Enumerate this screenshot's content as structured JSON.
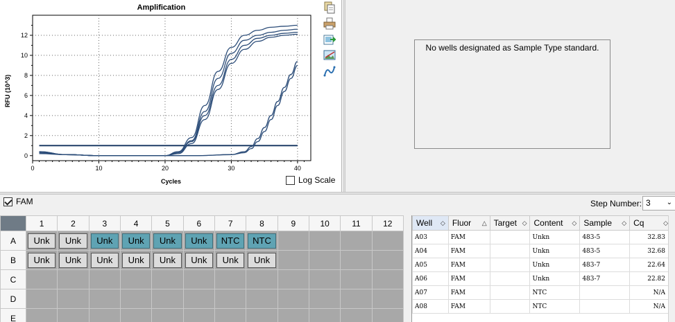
{
  "chart": {
    "title": "Amplification",
    "ylabel": "RFU (10^3)",
    "xlabel": "Cycles",
    "log_scale_label": "Log Scale"
  },
  "chart_data": {
    "type": "line",
    "title": "Amplification",
    "xlabel": "Cycles",
    "ylabel": "RFU (10^3)",
    "xlim": [
      0,
      42
    ],
    "ylim": [
      -0.5,
      14
    ],
    "xticks": [
      0,
      10,
      20,
      30,
      40
    ],
    "yticks": [
      0,
      2,
      4,
      6,
      8,
      10,
      12
    ],
    "threshold": 1.0,
    "grid": true,
    "series": [
      {
        "name": "A03",
        "x": [
          1,
          5,
          10,
          15,
          20,
          22,
          24,
          26,
          28,
          30,
          32,
          34,
          36,
          38,
          40
        ],
        "y": [
          0.4,
          0.1,
          0,
          0,
          0,
          0.3,
          1.4,
          4.0,
          7.0,
          9.6,
          11.0,
          11.7,
          12.0,
          12.2,
          12.3
        ]
      },
      {
        "name": "A04",
        "x": [
          1,
          5,
          10,
          15,
          20,
          22,
          24,
          26,
          28,
          30,
          32,
          34,
          36,
          38,
          40
        ],
        "y": [
          0.3,
          0.1,
          0,
          0,
          0,
          0.2,
          1.2,
          3.6,
          6.6,
          9.2,
          10.6,
          11.4,
          11.8,
          12.0,
          12.1
        ]
      },
      {
        "name": "A05",
        "x": [
          1,
          5,
          10,
          15,
          20,
          22,
          24,
          26,
          28,
          30,
          32,
          34,
          36,
          38,
          40
        ],
        "y": [
          0.4,
          0.1,
          0,
          0,
          0,
          0.4,
          1.8,
          5.0,
          8.4,
          10.8,
          12.0,
          12.5,
          12.8,
          12.9,
          13.0
        ]
      },
      {
        "name": "A06",
        "x": [
          1,
          5,
          10,
          15,
          20,
          22,
          24,
          26,
          28,
          30,
          32,
          34,
          36,
          38,
          40
        ],
        "y": [
          0.3,
          0.1,
          0,
          0,
          0,
          0.3,
          1.5,
          4.4,
          7.7,
          10.2,
          11.5,
          12.0,
          12.3,
          12.5,
          12.6
        ]
      },
      {
        "name": "A07",
        "x": [
          1,
          5,
          10,
          15,
          20,
          25,
          30,
          32,
          33,
          34,
          35,
          36,
          37,
          38,
          39,
          40
        ],
        "y": [
          0.3,
          0.1,
          0,
          0,
          0,
          0,
          0.1,
          0.4,
          0.9,
          1.7,
          2.8,
          4.0,
          5.4,
          6.8,
          8.1,
          9.4
        ]
      },
      {
        "name": "A08",
        "x": [
          1,
          5,
          10,
          15,
          20,
          25,
          30,
          32,
          33,
          34,
          35,
          36,
          37,
          38,
          39,
          40
        ],
        "y": [
          0.2,
          0.1,
          0,
          0,
          0,
          0,
          0.1,
          0.3,
          0.7,
          1.4,
          2.4,
          3.6,
          5.0,
          6.4,
          7.7,
          9.0
        ]
      }
    ]
  },
  "toolbar_icons": [
    "copy-icon",
    "print-icon",
    "export-icon",
    "image-icon",
    "chart-settings-icon"
  ],
  "standard": {
    "message": "No wells designated as Sample Type standard."
  },
  "fam": {
    "label": "FAM"
  },
  "step": {
    "label": "Step Number:",
    "value": "3"
  },
  "plate": {
    "columns": [
      "1",
      "2",
      "3",
      "4",
      "5",
      "6",
      "7",
      "8",
      "9",
      "10",
      "11",
      "12"
    ],
    "rows": [
      "A",
      "B",
      "C",
      "D",
      "E"
    ],
    "wells": {
      "A": [
        "Unk",
        "Unk",
        "Unk",
        "Unk",
        "Unk",
        "Unk",
        "NTC",
        "NTC",
        "",
        "",
        "",
        ""
      ],
      "B": [
        "Unk",
        "Unk",
        "Unk",
        "Unk",
        "Unk",
        "Unk",
        "Unk",
        "Unk",
        "",
        "",
        "",
        ""
      ],
      "C": [
        "",
        "",
        "",
        "",
        "",
        "",
        "",
        "",
        "",
        "",
        "",
        ""
      ],
      "D": [
        "",
        "",
        "",
        "",
        "",
        "",
        "",
        "",
        "",
        "",
        "",
        ""
      ],
      "E": [
        "",
        "",
        "",
        "",
        "",
        "",
        "",
        "",
        "",
        "",
        "",
        ""
      ]
    },
    "selected_A": [
      false,
      false,
      true,
      true,
      true,
      true,
      true,
      true,
      false,
      false,
      false,
      false
    ]
  },
  "results": {
    "headers": [
      "Well",
      "Fluor",
      "Target",
      "Content",
      "Sample",
      "Cq"
    ],
    "rows": [
      [
        "A03",
        "FAM",
        "",
        "Unkn",
        "483-5",
        "32.83"
      ],
      [
        "A04",
        "FAM",
        "",
        "Unkn",
        "483-5",
        "32.68"
      ],
      [
        "A05",
        "FAM",
        "",
        "Unkn",
        "483-7",
        "22.64"
      ],
      [
        "A06",
        "FAM",
        "",
        "Unkn",
        "483-7",
        "22.82"
      ],
      [
        "A07",
        "FAM",
        "",
        "NTC",
        "",
        "N/A"
      ],
      [
        "A08",
        "FAM",
        "",
        "NTC",
        "",
        "N/A"
      ]
    ]
  }
}
